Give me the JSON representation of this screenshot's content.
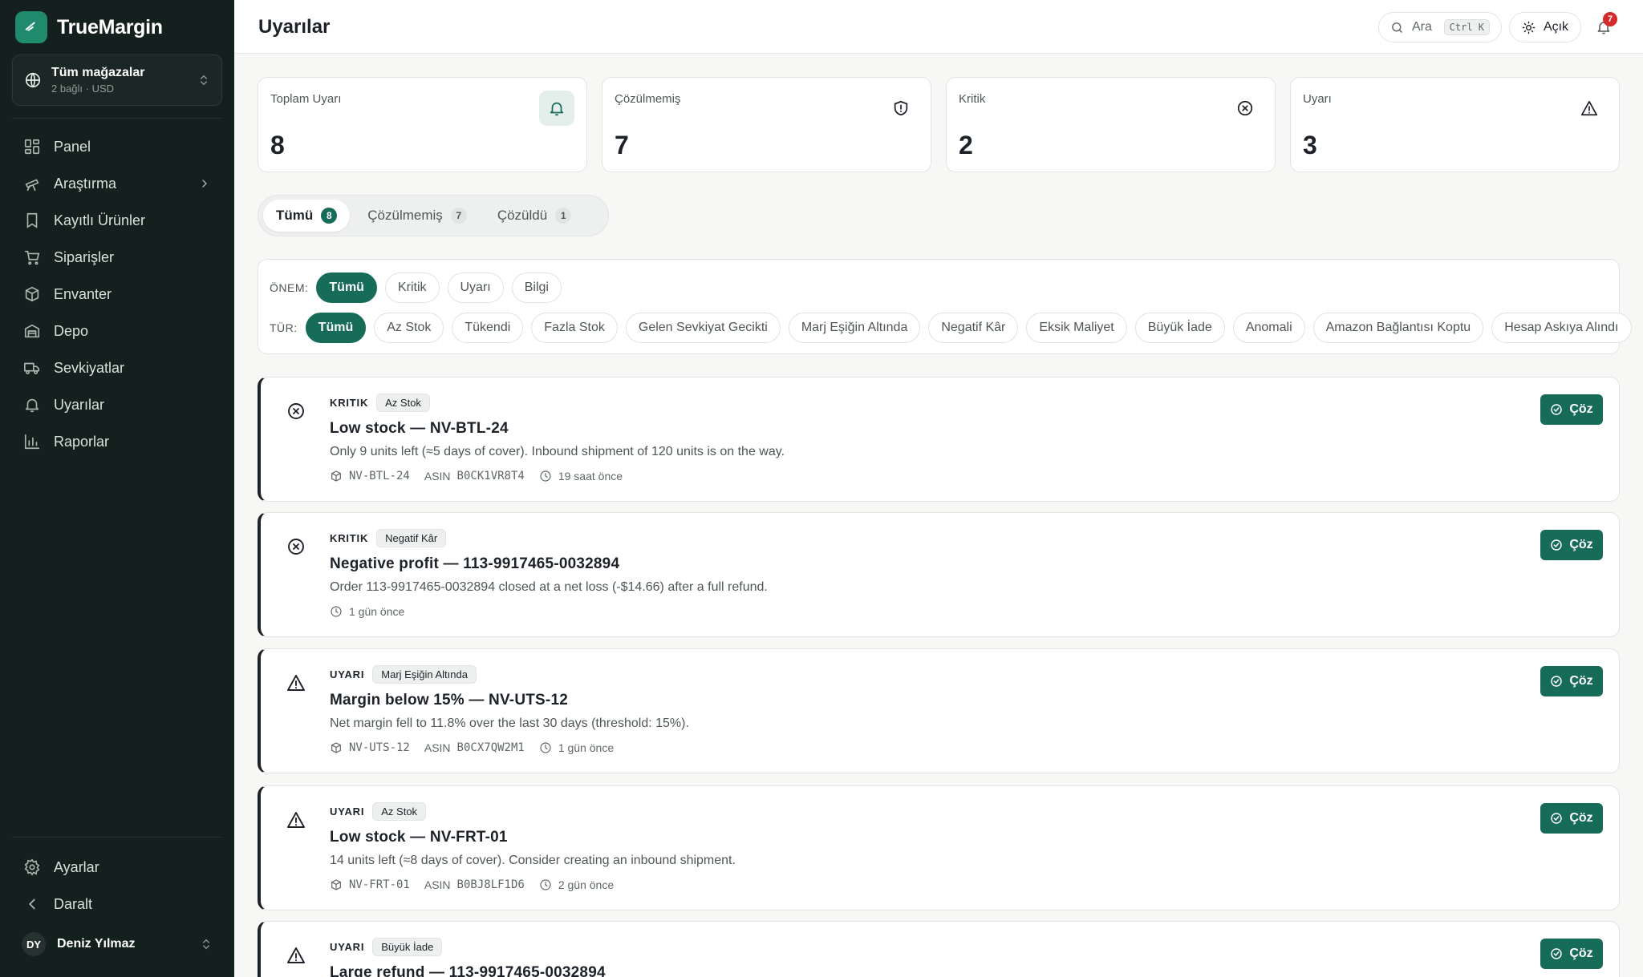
{
  "app": {
    "name": "TrueMargin"
  },
  "store": {
    "title": "Tüm mağazalar",
    "subtitle": "2 bağlı · USD"
  },
  "nav": [
    {
      "label": "Panel",
      "icon": "dashboard-icon"
    },
    {
      "label": "Araştırma",
      "icon": "telescope-icon"
    },
    {
      "label": "Kayıtlı Ürünler",
      "icon": "bookmark-icon"
    },
    {
      "label": "Siparişler",
      "icon": "cart-icon"
    },
    {
      "label": "Envanter",
      "icon": "box-icon"
    },
    {
      "label": "Depo",
      "icon": "warehouse-icon"
    },
    {
      "label": "Sevkiyatlar",
      "icon": "truck-icon"
    },
    {
      "label": "Uyarılar",
      "icon": "bell-icon"
    },
    {
      "label": "Raporlar",
      "icon": "bar-chart-icon"
    }
  ],
  "bottom_nav": {
    "settings": "Ayarlar",
    "collapse": "Daralt"
  },
  "user": {
    "initials": "DY",
    "name": "Deniz Yılmaz"
  },
  "header": {
    "title": "Uyarılar",
    "search_label": "Ara",
    "search_shortcut": "Ctrl K",
    "theme_label": "Açık",
    "notification_count": "7"
  },
  "stats": [
    {
      "label": "Toplam Uyarı",
      "value": "8",
      "icon": "bell-icon"
    },
    {
      "label": "Çözülmemiş",
      "value": "7",
      "icon": "shield-alert-icon"
    },
    {
      "label": "Kritik",
      "value": "2",
      "icon": "circle-x-icon"
    },
    {
      "label": "Uyarı",
      "value": "3",
      "icon": "triangle-alert-icon"
    }
  ],
  "tabs": [
    {
      "label": "Tümü",
      "count": "8",
      "active": true
    },
    {
      "label": "Çözülmemiş",
      "count": "7",
      "active": false
    },
    {
      "label": "Çözüldü",
      "count": "1",
      "active": false
    }
  ],
  "filters": {
    "severity_label": "ÖNEM:",
    "severity": [
      "Tümü",
      "Kritik",
      "Uyarı",
      "Bilgi"
    ],
    "type_label": "TÜR:",
    "types": [
      "Tümü",
      "Az Stok",
      "Tükendi",
      "Fazla Stok",
      "Gelen Sevkiyat Gecikti",
      "Marj Eşiğin Altında",
      "Negatif Kâr",
      "Eksik Maliyet",
      "Büyük İade",
      "Anomali",
      "Amazon Bağlantısı Koptu",
      "Hesap Askıya Alındı"
    ]
  },
  "resolve_label": "Çöz",
  "alerts": [
    {
      "severity": "KRITIK",
      "icon": "circle-x-icon",
      "type": "Az Stok",
      "title": "Low stock — NV-BTL-24",
      "description": "Only 9 units left (≈5 days of cover). Inbound shipment of 120 units is on the way.",
      "sku": "NV-BTL-24",
      "asin_label": "ASIN",
      "asin": "B0CK1VR8T4",
      "time": "19 saat önce"
    },
    {
      "severity": "KRITIK",
      "icon": "circle-x-icon",
      "type": "Negatif Kâr",
      "title": "Negative profit — 113-9917465-0032894",
      "description": "Order 113-9917465-0032894 closed at a net loss (-$14.66) after a full refund.",
      "sku": "",
      "asin_label": "",
      "asin": "",
      "time": "1 gün önce"
    },
    {
      "severity": "UYARI",
      "icon": "triangle-alert-icon",
      "type": "Marj Eşiğin Altında",
      "title": "Margin below 15% — NV-UTS-12",
      "description": "Net margin fell to 11.8% over the last 30 days (threshold: 15%).",
      "sku": "NV-UTS-12",
      "asin_label": "ASIN",
      "asin": "B0CX7QW2M1",
      "time": "1 gün önce"
    },
    {
      "severity": "UYARI",
      "icon": "triangle-alert-icon",
      "type": "Az Stok",
      "title": "Low stock — NV-FRT-01",
      "description": "14 units left (≈8 days of cover). Consider creating an inbound shipment.",
      "sku": "NV-FRT-01",
      "asin_label": "ASIN",
      "asin": "B0BJ8LF1D6",
      "time": "2 gün önce"
    },
    {
      "severity": "UYARI",
      "icon": "triangle-alert-icon",
      "type": "Büyük İade",
      "title": "Large refund — 113-9917465-0032894",
      "description": "",
      "sku": "",
      "asin_label": "",
      "asin": "",
      "time": ""
    }
  ],
  "colors": {
    "accent": "#176b59",
    "sidebar": "#14201e",
    "badge": "#d52a2a"
  }
}
